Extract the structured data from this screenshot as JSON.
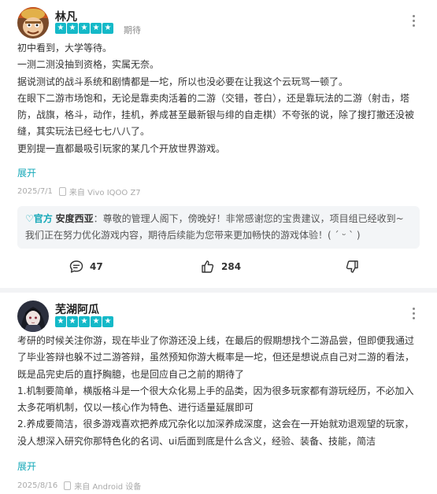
{
  "reviews": [
    {
      "username": "林凡",
      "rating": 5,
      "tag": "期待",
      "lines": [
        "初中看到，大学等待。",
        "一测二测没抽到资格，实属无奈。",
        "据说测试的战斗系统和剧情都是一坨，所以也没必要在让我这个云玩骂一顿了。",
        "在眼下二游市场饱和，无论是靠卖肉活着的二游（交错，苍白），还是靠玩法的二游（射击，塔防，战旗，格斗，动作，挂机，养成甚至最新银与绯的自走棋）不夸张的说，除了搜打撤还没被缝，其实玩法已经七七八八了。",
        "更别提一直都最吸引玩家的某几个开放世界游戏。"
      ],
      "expand_label": "展开",
      "date": "2025/7/1",
      "device": "来自 Vivo IQOO Z7",
      "reply": {
        "official_label": "官方",
        "developer": "安度西亚",
        "text": "：尊敬的管理人阁下，傍晚好！非常感谢您的宝贵建议，项目组已经收到~我们正在努力优化游戏内容，期待后续能为您带来更加畅快的游戏体验！( ˊ ᵕ ˋ )"
      },
      "comment_count": "47",
      "like_count": "284"
    },
    {
      "username": "芜湖阿瓜",
      "rating": 5,
      "tag": "",
      "lines": [
        "考研的时候关注你游，现在毕业了你游还没上线，在最后的假期想找个二游品尝，但即便我通过了毕业答辩也躲不过二游答辩，虽然预知你游大概率是一坨，但还是想说点自己对二游的看法，既是品完史后的直抒胸臆，也是回应自己之前的期待了",
        "1.机制要简单，横版格斗是一个很大众化易上手的品类，因为很多玩家都有游玩经历，不必加入太多花哨机制，仅以一核心作为特色、进行适量延展即可",
        "2.养成要简洁，很多游戏喜欢把养成冗杂化以加深养成深度，这会在一开始就劝退观望的玩家，没人想深入研究你那特色化的名词、ui后面到底是什么含义，经验、装备、技能，简洁"
      ],
      "expand_label": "展开",
      "date": "2025/8/16",
      "device": "来自 Android 设备"
    }
  ],
  "colors": {
    "accent": "#14b9c8",
    "link": "#14a8b8"
  }
}
